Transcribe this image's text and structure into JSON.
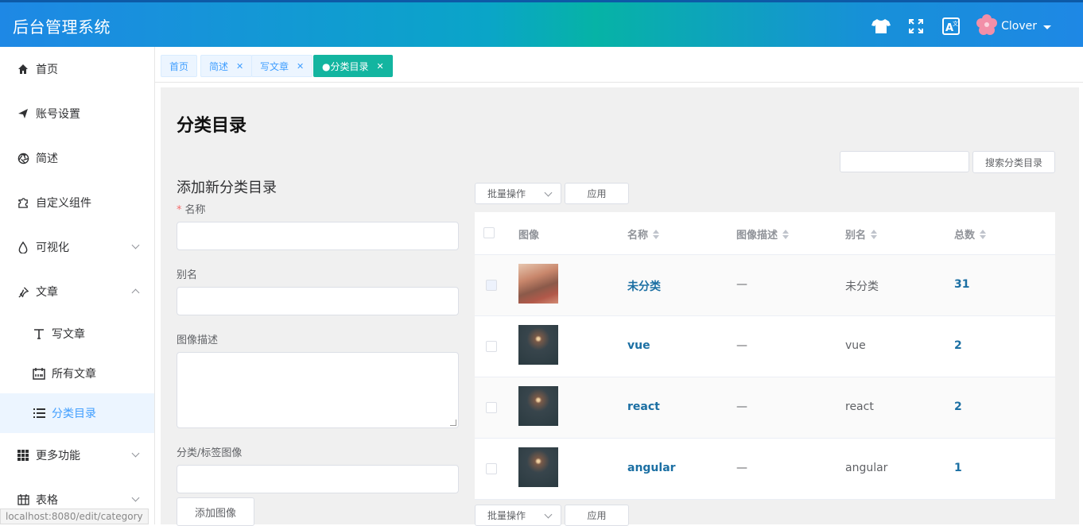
{
  "app": {
    "title": "后台管理系统"
  },
  "header": {
    "icons": [
      "tshirt-icon",
      "fullscreen-icon",
      "translate-icon"
    ],
    "user": {
      "name": "Clover"
    }
  },
  "sidebar": {
    "items": [
      {
        "label": "首页",
        "icon": "home-icon"
      },
      {
        "label": "账号设置",
        "icon": "send-icon"
      },
      {
        "label": "简述",
        "icon": "aperture-icon"
      },
      {
        "label": "自定义组件",
        "icon": "puzzle-icon"
      },
      {
        "label": "可视化",
        "icon": "drop-icon"
      },
      {
        "label": "文章",
        "icon": "pin-icon"
      },
      {
        "label": "写文章",
        "icon": "text-icon"
      },
      {
        "label": "所有文章",
        "icon": "calendar-icon"
      },
      {
        "label": "分类目录",
        "icon": "list-icon"
      },
      {
        "label": "更多功能",
        "icon": "grid-icon"
      },
      {
        "label": "表格",
        "icon": "table-icon"
      }
    ],
    "status_url": "localhost:8080/edit/category"
  },
  "tags": [
    {
      "label": "首页",
      "closable": false
    },
    {
      "label": "简述",
      "closable": true
    },
    {
      "label": "写文章",
      "closable": true
    },
    {
      "label": "●分类目录",
      "closable": true,
      "active": true
    }
  ],
  "page": {
    "title": "分类目录",
    "search_button": "搜索分类目录",
    "search_placeholder": ""
  },
  "form": {
    "title": "添加新分类目录",
    "fields": {
      "name": {
        "label": "名称",
        "required": true,
        "value": ""
      },
      "alias": {
        "label": "别名",
        "value": ""
      },
      "desc": {
        "label": "图像描述",
        "value": ""
      },
      "image": {
        "label": "分类/标签图像",
        "value": ""
      }
    },
    "add_image_button": "添加图像"
  },
  "bulk": {
    "select_label": "批量操作",
    "apply_label": "应用"
  },
  "table": {
    "columns": [
      "图像",
      "名称",
      "图像描述",
      "别名",
      "总数"
    ],
    "rows": [
      {
        "name": "未分类",
        "desc": "—",
        "alias": "未分类",
        "count": "31",
        "thumb": "autumn"
      },
      {
        "name": "vue",
        "desc": "—",
        "alias": "vue",
        "count": "2",
        "thumb": "dark"
      },
      {
        "name": "react",
        "desc": "—",
        "alias": "react",
        "count": "2",
        "thumb": "dark"
      },
      {
        "name": "angular",
        "desc": "—",
        "alias": "angular",
        "count": "1",
        "thumb": "dark"
      }
    ]
  }
}
